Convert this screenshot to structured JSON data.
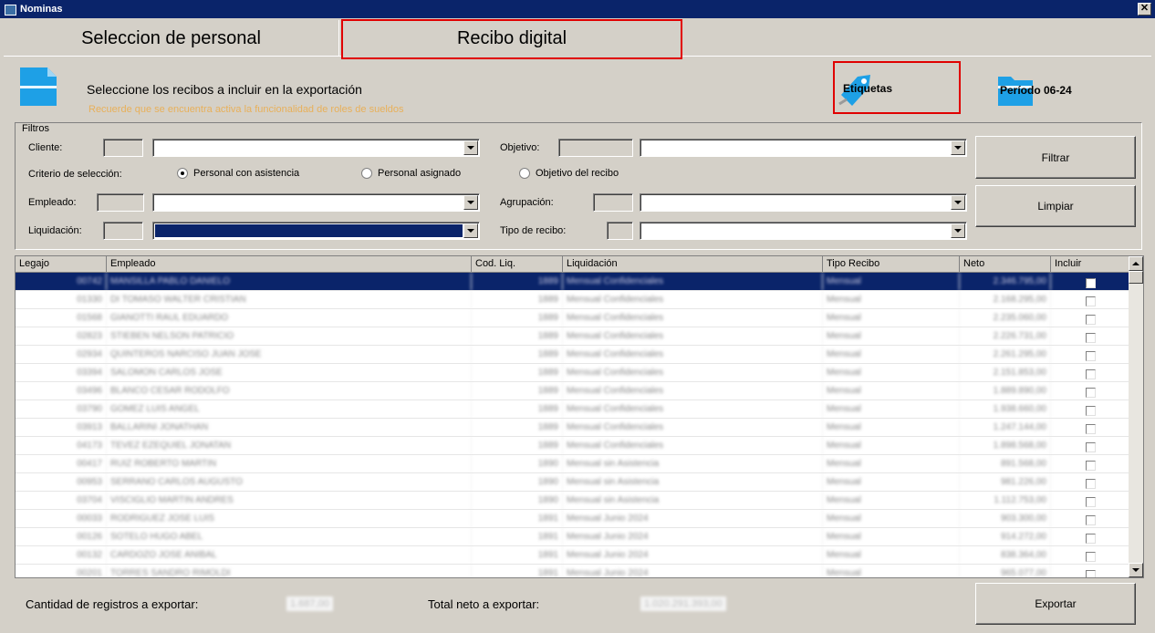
{
  "window": {
    "title": "Nominas",
    "close_icon": "close-icon"
  },
  "tabs": [
    {
      "label": "Seleccion de personal"
    },
    {
      "label": "Recibo digital"
    }
  ],
  "header": {
    "title": "Seleccione los recibos a incluir en la exportación",
    "subtitle": "Recuerde que se encuentra activa la funcionalidad de roles de sueldos",
    "etiquetas_label": "Etiquetas",
    "periodo_label": "Período 06-24"
  },
  "filters": {
    "legend": "Filtros",
    "cliente_label": "Cliente:",
    "objetivo_label": "Objetivo:",
    "criterio_label": "Criterio de selección:",
    "radios": [
      {
        "label": "Personal con asistencia",
        "checked": true
      },
      {
        "label": "Personal asignado",
        "checked": false
      },
      {
        "label": "Objetivo del recibo",
        "checked": false
      }
    ],
    "empleado_label": "Empleado:",
    "agrupacion_label": "Agrupación:",
    "liquidacion_label": "Liquidación:",
    "tipo_recibo_label": "Tipo de recibo:",
    "filtrar_label": "Filtrar",
    "limpiar_label": "Limpiar"
  },
  "grid": {
    "columns": [
      "Legajo",
      "Empleado",
      "Cod. Liq.",
      "Liquidación",
      "Tipo Recibo",
      "Neto",
      "Incluir"
    ],
    "rows": [
      [
        "00742",
        "MANSILLA PABLO DANIELO",
        "1889",
        "Mensual Confidenciales",
        "Mensual",
        "2.346.795,00"
      ],
      [
        "01330",
        "DI TOMASO WALTER CRISTIAN",
        "1889",
        "Mensual Confidenciales",
        "Mensual",
        "2.168.295,00"
      ],
      [
        "01568",
        "GIANOTTI RAUL EDUARDO",
        "1889",
        "Mensual Confidenciales",
        "Mensual",
        "2.235.060,00"
      ],
      [
        "02823",
        "STIEBEN NELSON PATRICIO",
        "1889",
        "Mensual Confidenciales",
        "Mensual",
        "2.226.731,00"
      ],
      [
        "02934",
        "QUINTEROS NARCISO JUAN JOSE",
        "1889",
        "Mensual Confidenciales",
        "Mensual",
        "2.261.295,00"
      ],
      [
        "03394",
        "SALOMON CARLOS JOSE",
        "1889",
        "Mensual Confidenciales",
        "Mensual",
        "2.151.853,00"
      ],
      [
        "03496",
        "BLANCO CESAR RODOLFO",
        "1889",
        "Mensual Confidenciales",
        "Mensual",
        "1.889.890,00"
      ],
      [
        "03790",
        "GOMEZ LUIS ANGEL",
        "1889",
        "Mensual Confidenciales",
        "Mensual",
        "1.938.660,00"
      ],
      [
        "03913",
        "BALLARINI JONATHAN",
        "1889",
        "Mensual Confidenciales",
        "Mensual",
        "1.247.144,00"
      ],
      [
        "04173",
        "TEVEZ EZEQUIEL JONATAN",
        "1889",
        "Mensual Confidenciales",
        "Mensual",
        "1.898.568,00"
      ],
      [
        "00417",
        "RUIZ ROBERTO MARTIN",
        "1890",
        "Mensual sin Asistencia",
        "Mensual",
        "891.568,00"
      ],
      [
        "00953",
        "SERRANO CARLOS AUGUSTO",
        "1890",
        "Mensual sin Asistencia",
        "Mensual",
        "981.226,00"
      ],
      [
        "03704",
        "VISCIGLIO MARTIN ANDRES",
        "1890",
        "Mensual sin Asistencia",
        "Mensual",
        "1.112.753,00"
      ],
      [
        "00033",
        "RODRIGUEZ JOSE LUIS",
        "1891",
        "Mensual Junio 2024",
        "Mensual",
        "903.300,00"
      ],
      [
        "00126",
        "SOTELO HUGO ABEL",
        "1891",
        "Mensual Junio 2024",
        "Mensual",
        "914.272,00"
      ],
      [
        "00132",
        "CARDOZO JOSE ANIBAL",
        "1891",
        "Mensual Junio 2024",
        "Mensual",
        "838.364,00"
      ],
      [
        "00201",
        "TORRES SANDRO RIMOLDI",
        "1891",
        "Mensual Junio 2024",
        "Mensual",
        "965.077,00"
      ]
    ]
  },
  "footer": {
    "cantidad_label": "Cantidad de registros a exportar:",
    "cantidad_value": "1.687,00",
    "total_label": "Total neto a exportar:",
    "total_value": "1.020.291.393,00",
    "exportar_label": "Exportar"
  },
  "colors": {
    "titlebar": "#0a246a",
    "face": "#d4d0c8",
    "selection": "#0a246a",
    "highlight": "#e00000",
    "icon_blue": "#1ea0e6"
  }
}
